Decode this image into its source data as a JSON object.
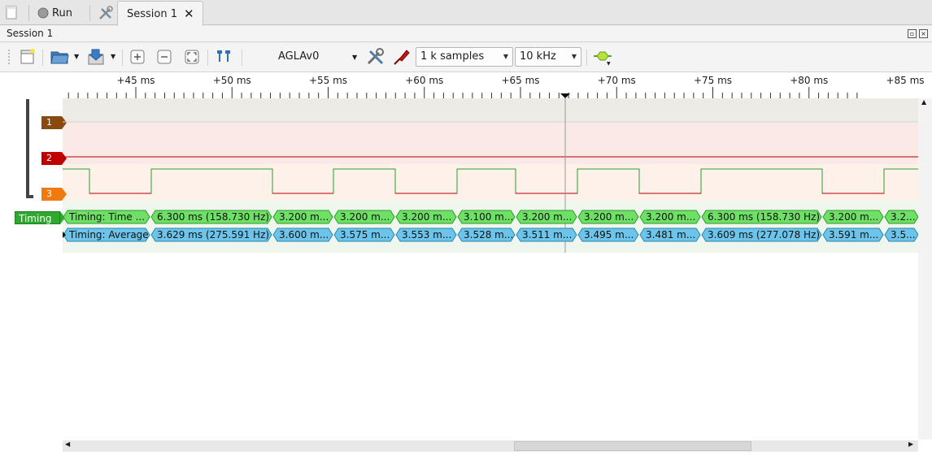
{
  "tabbar": {
    "run_label": "Run",
    "session_tab_label": "Session 1",
    "close_glyph": "🗙"
  },
  "session": {
    "title": "Session 1"
  },
  "toolbar": {
    "device": "AGLAv0",
    "samples": "1 k samples",
    "samplerate": "10 kHz"
  },
  "ruler": {
    "ticks": [
      "+45 ms",
      "+50 ms",
      "+55 ms",
      "+60 ms",
      "+65 ms",
      "+70 ms",
      "+75 ms",
      "+80 ms",
      "+85 ms"
    ]
  },
  "channels": [
    {
      "label": "1",
      "color": "#8a4a0f"
    },
    {
      "label": "2",
      "color": "#c00000"
    },
    {
      "label": "3",
      "color": "#f07a0c"
    }
  ],
  "decoder": {
    "label": "Timing",
    "row_time": [
      "Timing: Time ...",
      "6.300 ms (158.730 Hz)",
      "3.200 m...",
      "3.200 m...",
      "3.200 m...",
      "3.100 m...",
      "3.200 m...",
      "3.200 m...",
      "3.200 m...",
      "6.300 ms (158.730 Hz)",
      "3.200 m...",
      "3.2..."
    ],
    "row_avg": [
      "Timing: Average",
      "3.629 ms (275.591 Hz)",
      "3.600 m...",
      "3.575 m...",
      "3.553 m...",
      "3.528 m...",
      "3.511 m...",
      "3.495 m...",
      "3.481 m...",
      "3.609 ms (277.078 Hz)",
      "3.591 m...",
      "3.5..."
    ]
  },
  "colors": {
    "ann_time": "#6ee066",
    "ann_avg": "#6dc4ea",
    "trace": "#2aa02a",
    "accent": "#2a6fc0"
  }
}
